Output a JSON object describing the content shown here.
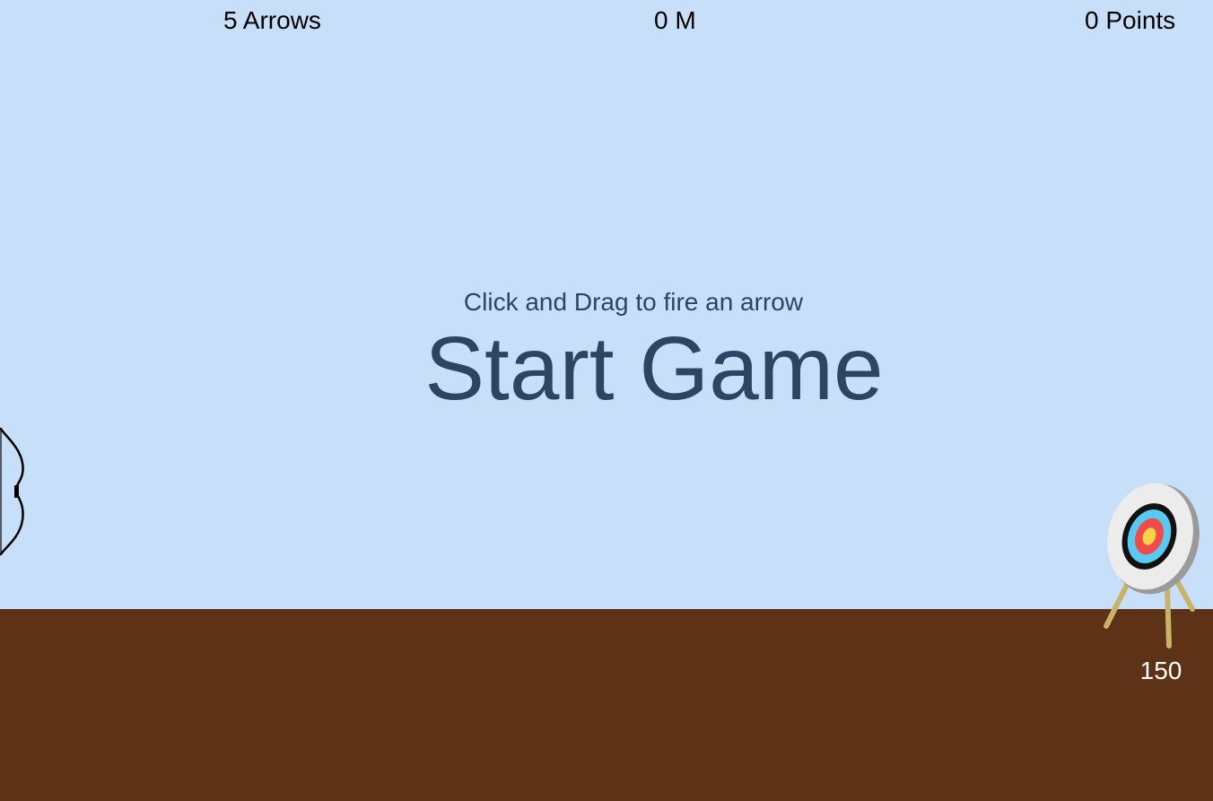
{
  "hud": {
    "arrows": "5 Arrows",
    "distance": "0 M",
    "points": "0 Points"
  },
  "overlay": {
    "instructions": "Click and Drag to fire an arrow",
    "start_label": "Start Game"
  },
  "target": {
    "distance_label": "150"
  },
  "colors": {
    "sky": "#c8dff9",
    "ground": "#5e3216",
    "overlay_text": "#2f4462",
    "target_outer": "#ececec",
    "target_black": "#111111",
    "target_blue": "#5bc8ef",
    "target_red": "#ef4b4b",
    "target_yellow": "#f8d24a",
    "target_legs": "#c9b26a"
  },
  "icons": {
    "bow": "bow-icon",
    "target": "archery-target-icon"
  }
}
